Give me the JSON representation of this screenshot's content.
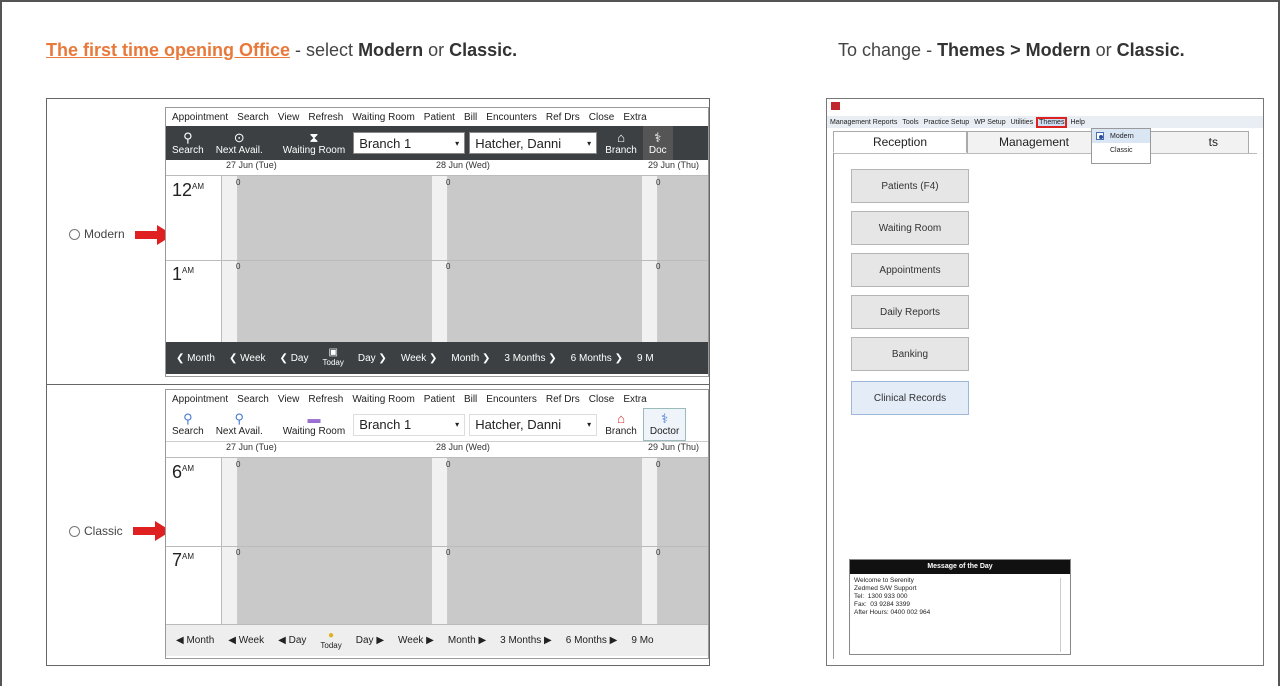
{
  "header": {
    "left_link": "The first time opening Office",
    "left_mid": " - select ",
    "left_b1": "Modern",
    "left_or": " or ",
    "left_b2": "Classic.",
    "right_pre": "To change - ",
    "right_b1": "Themes > Modern",
    "right_or": " or ",
    "right_b2": "Classic."
  },
  "left_image": {
    "menu": [
      "Appointment",
      "Search",
      "View",
      "Refresh",
      "Waiting Room",
      "Patient",
      "Bill",
      "Encounters",
      "Ref Drs",
      "Close",
      "Extra"
    ],
    "modern": {
      "radio_label": "Modern",
      "toolbar": {
        "search": "Search",
        "next": "Next Avail.",
        "waiting": "Waiting Room",
        "branch_select": "Branch 1",
        "doctor_select": "Hatcher, Danni",
        "branch": "Branch",
        "doctor": "Doc"
      },
      "dates": [
        "27 Jun (Tue)",
        "28 Jun (Wed)",
        "29 Jun (Thu)"
      ],
      "times": [
        "12",
        "1"
      ],
      "time_suffix": "AM",
      "nav": {
        "month": "Month",
        "week": "Week",
        "day": "Day",
        "today": "Today",
        "day_f": "Day",
        "week_f": "Week",
        "month_f": "Month",
        "three": "3 Months",
        "six": "6 Months",
        "nine": "9 M"
      }
    },
    "classic": {
      "radio_label": "Classic",
      "toolbar": {
        "search": "Search",
        "next": "Next Avail.",
        "waiting": "Waiting Room",
        "branch_select": "Branch 1",
        "doctor_select": "Hatcher, Danni",
        "branch": "Branch",
        "doctor": "Doctor"
      },
      "dates": [
        "27 Jun (Tue)",
        "28 Jun (Wed)",
        "29 Jun (Thu)"
      ],
      "times": [
        "6",
        "7"
      ],
      "time_suffix": "AM",
      "nav": {
        "month": "Month",
        "week": "Week",
        "day": "Day",
        "today": "Today",
        "day_f": "Day",
        "week_f": "Week",
        "month_f": "Month",
        "three": "3 Months",
        "six": "6 Months",
        "nine": "9 Mo"
      }
    },
    "zero": "0"
  },
  "right_image": {
    "menu": [
      "Management Reports",
      "Tools",
      "Practice Setup",
      "WP Setup",
      "Utilities",
      "Themes",
      "Help"
    ],
    "tabs": [
      "Reception",
      "Management",
      "ts"
    ],
    "dropdown": [
      "Modern",
      "Classic"
    ],
    "buttons": [
      "Patients (F4)",
      "Waiting Room",
      "Appointments",
      "Daily Reports",
      "Banking",
      "Clinical Records"
    ],
    "motd_title": "Message of the Day",
    "motd_text": "Welcome to Serenity\nZedmed S/W Support\nTel:  1300 933 000\nFax:  03 9284 3399\nAfter Hours: 0400 002 964"
  },
  "colors": {
    "link": "#e8793a",
    "modern_bar": "#3c4043",
    "slot_gray": "#c9c9c9",
    "arrow": "#e02020",
    "highlight": "#d22222"
  }
}
